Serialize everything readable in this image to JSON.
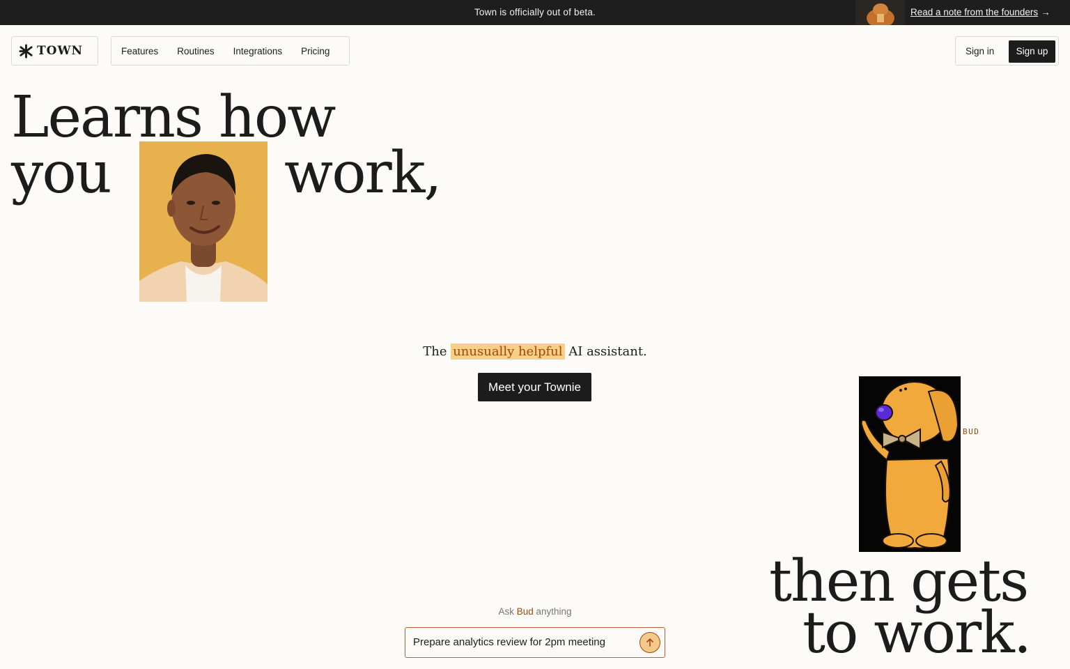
{
  "announcement": {
    "text": "Town is officially out of beta.",
    "link_label": "Read a note from the founders",
    "link_arrow": "→"
  },
  "brand": {
    "name": "TOWN",
    "logo_icon": "asterisk-star-icon"
  },
  "nav": {
    "items": [
      {
        "label": "Features"
      },
      {
        "label": "Routines"
      },
      {
        "label": "Integrations"
      },
      {
        "label": "Pricing"
      }
    ]
  },
  "auth": {
    "signin_label": "Sign in",
    "signup_label": "Sign up"
  },
  "hero": {
    "line1": "Learns how",
    "line2_a": "you",
    "line2_b": "work,",
    "line3": "then gets",
    "line4": "to work."
  },
  "tagline": {
    "before": "The",
    "highlight": "unusually helpful",
    "after": "AI assistant."
  },
  "cta": {
    "label": "Meet your Townie"
  },
  "bud": {
    "label": "BUD"
  },
  "ask": {
    "prefix": "Ask",
    "name": "Bud",
    "suffix": "anything",
    "value": "Prepare analytics review for 2pm meeting",
    "send_icon": "arrow-up-icon"
  },
  "colors": {
    "background": "#fcfbf8",
    "dark": "#1c1c1c",
    "accent": "#a3470a",
    "highlight": "#f7cf87",
    "portrait_bg": "#e7b24d"
  }
}
